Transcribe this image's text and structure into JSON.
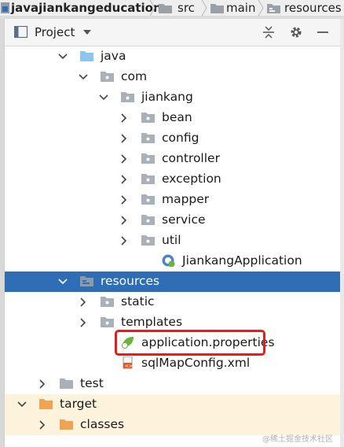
{
  "breadcrumb": {
    "project": "javajiankangeducation",
    "items": [
      "src",
      "main",
      "resources"
    ]
  },
  "header": {
    "title": "Project"
  },
  "tree": [
    {
      "label": "java",
      "kind": "folder-blue",
      "depth": 0,
      "expanded": true
    },
    {
      "label": "com",
      "kind": "package",
      "depth": 1,
      "expanded": true
    },
    {
      "label": "jiankang",
      "kind": "package",
      "depth": 2,
      "expanded": true
    },
    {
      "label": "bean",
      "kind": "package",
      "depth": 3,
      "expanded": false
    },
    {
      "label": "config",
      "kind": "package",
      "depth": 3,
      "expanded": false
    },
    {
      "label": "controller",
      "kind": "package",
      "depth": 3,
      "expanded": false
    },
    {
      "label": "exception",
      "kind": "package",
      "depth": 3,
      "expanded": false
    },
    {
      "label": "mapper",
      "kind": "package",
      "depth": 3,
      "expanded": false
    },
    {
      "label": "service",
      "kind": "package",
      "depth": 3,
      "expanded": false
    },
    {
      "label": "util",
      "kind": "package",
      "depth": 3,
      "expanded": false
    },
    {
      "label": "JiankangApplication",
      "kind": "spring-class",
      "depth": 4,
      "expanded": null
    },
    {
      "label": "resources",
      "kind": "folder-resources",
      "depth": 0,
      "expanded": true,
      "selected": true
    },
    {
      "label": "static",
      "kind": "package",
      "depth": 1,
      "expanded": false
    },
    {
      "label": "templates",
      "kind": "package",
      "depth": 1,
      "expanded": false
    },
    {
      "label": "application.properties",
      "kind": "spring-properties",
      "depth": 2,
      "expanded": null,
      "highlighted": true
    },
    {
      "label": "sqlMapConfig.xml",
      "kind": "xml",
      "depth": 2,
      "expanded": null
    },
    {
      "label": "test",
      "kind": "folder-gray",
      "depth": -1,
      "expanded": false
    },
    {
      "label": "target",
      "kind": "folder-orange",
      "depth": -2,
      "expanded": true,
      "orange": true
    },
    {
      "label": "classes",
      "kind": "folder-orange",
      "depth": -1,
      "expanded": false,
      "orange": true
    }
  ],
  "watermark": "@稀土掘金技术社区",
  "colors": {
    "selection": "#2f6eb5",
    "highlight": "#e02020",
    "target_bg": "#fdf3dc"
  }
}
